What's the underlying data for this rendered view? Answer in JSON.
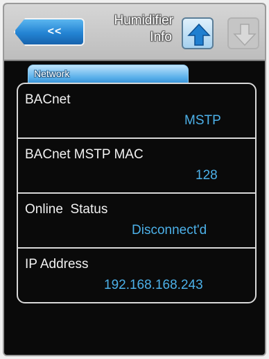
{
  "header": {
    "back_label": "<<",
    "title_line1": "Humidifier",
    "title_line2": "Info"
  },
  "tab": {
    "label": "Network"
  },
  "rows": [
    {
      "label": "BACnet",
      "value": "MSTP"
    },
    {
      "label": "BACnet MSTP MAC",
      "value": "128"
    },
    {
      "label": "Online  Status",
      "value": "Disconnect'd"
    },
    {
      "label": "IP Address",
      "value": "192.168.168.243"
    }
  ],
  "colors": {
    "accent_blue": "#4cb0e8",
    "background": "#0a0a0a",
    "header": "#c8c8c8"
  },
  "icons": {
    "up": "arrow-up-icon",
    "down": "arrow-down-icon"
  }
}
